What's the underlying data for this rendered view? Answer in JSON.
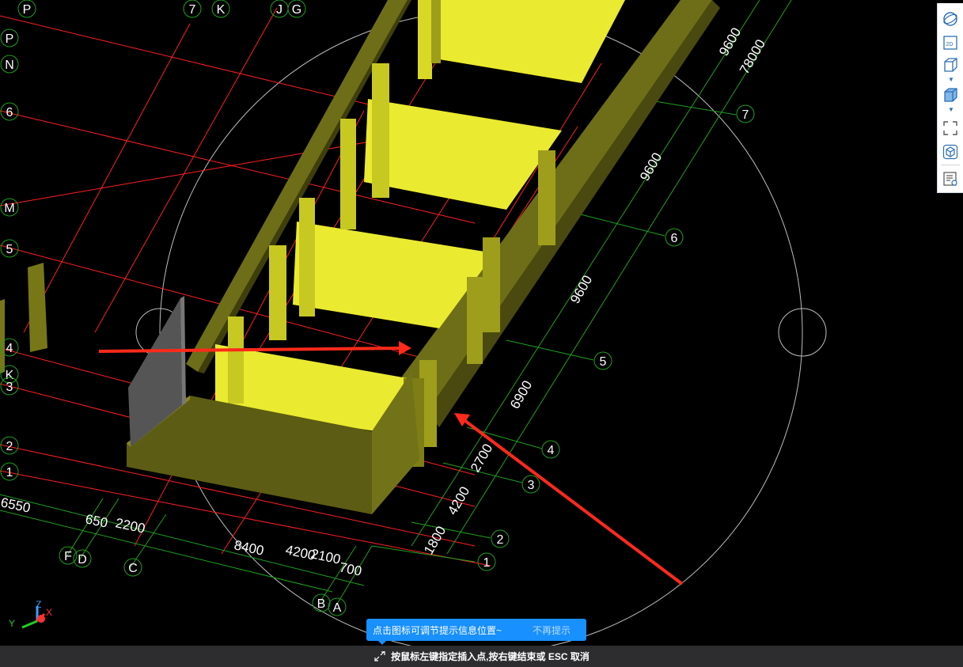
{
  "axes_labels": {
    "top": [
      "P",
      "7",
      "K",
      "J",
      "G"
    ],
    "left": [
      "P",
      "N",
      "6",
      "M",
      "5",
      "4",
      "K",
      "3",
      "2",
      "1"
    ],
    "right": [
      "7",
      "6",
      "5",
      "4",
      "3",
      "2",
      "1"
    ],
    "bottom": [
      "F",
      "D",
      "C",
      "B",
      "A"
    ]
  },
  "dimensions": {
    "right_side": [
      "9600",
      "78000",
      "9600",
      "9600",
      "6900",
      "2700",
      "4200",
      "1800"
    ],
    "bottom_side": [
      "6550",
      "650",
      "2200",
      "8400",
      "4200",
      "2100",
      "700"
    ]
  },
  "view_cube": {
    "x_label": "X",
    "y_label": "Y",
    "z_label": "Z"
  },
  "toolbar": {
    "items": [
      "orbit-icon",
      "view-2d-icon",
      "view-3d-box-icon",
      "view-3d-solid-icon",
      "zoom-extent-icon",
      "cube-view-icon",
      "properties-icon"
    ],
    "view_2d_label": "2D"
  },
  "tip": {
    "message": "点击图标可调节提示信息位置~",
    "dismiss": "不再提示"
  },
  "status": {
    "prompt": "按鼠标左键指定插入点,按右键结束或 ESC 取消"
  },
  "colors": {
    "background": "#000000",
    "wall_light": "#e8e830",
    "wall_dark": "#5c5c14",
    "grid_red": "#ff2020",
    "grid_green": "#1fa01f",
    "annotation_arrow": "#ff2a1a",
    "tip_blue": "#1890ff"
  }
}
